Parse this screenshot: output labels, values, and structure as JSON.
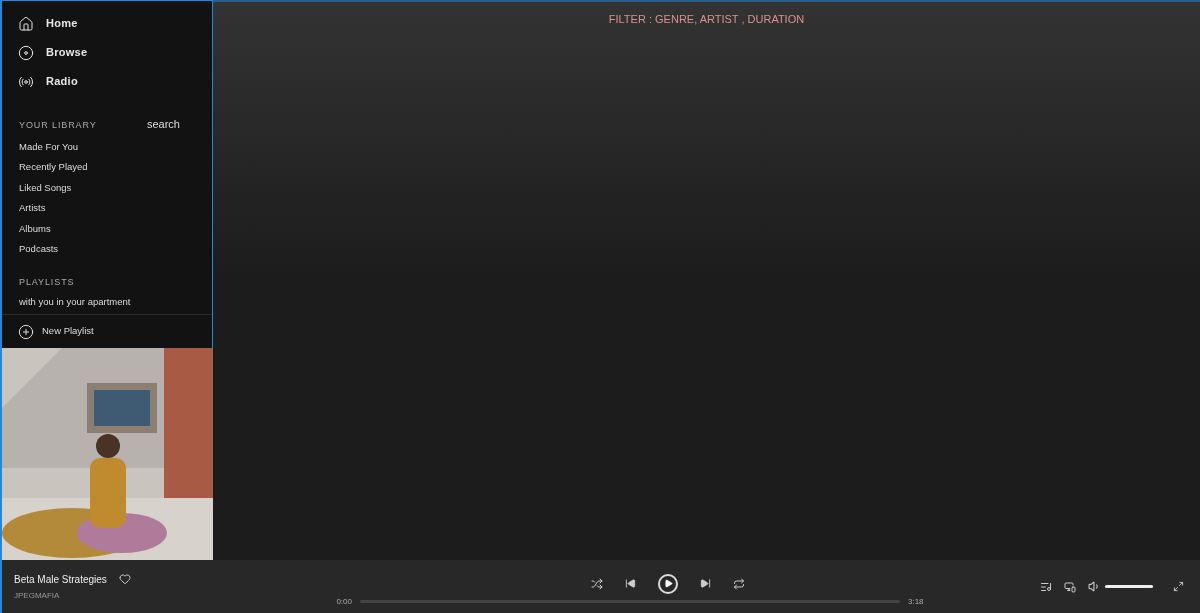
{
  "nav": [
    {
      "kind": "home",
      "label": "Home"
    },
    {
      "kind": "browse",
      "label": "Browse"
    },
    {
      "kind": "radio",
      "label": "Radio"
    }
  ],
  "library": {
    "heading": "YOUR LIBRARY",
    "search": "search",
    "items": [
      "Made For You",
      "Recently Played",
      "Liked Songs",
      "Artists",
      "Albums",
      "Podcasts"
    ]
  },
  "playlists": {
    "heading": "PLAYLISTS",
    "items": [
      "with you in your apartment"
    ]
  },
  "new_playlist": "New Playlist",
  "filter": "FILTER : GENRE, ARTIST , DURATION",
  "player": {
    "track": "Beta Male Strategies",
    "artist": "JPEGMAFIA",
    "liked": false,
    "elapsed": "0:00",
    "duration": "3:18",
    "progress": {
      "level": 0
    },
    "volume": {
      "level": 1
    }
  }
}
